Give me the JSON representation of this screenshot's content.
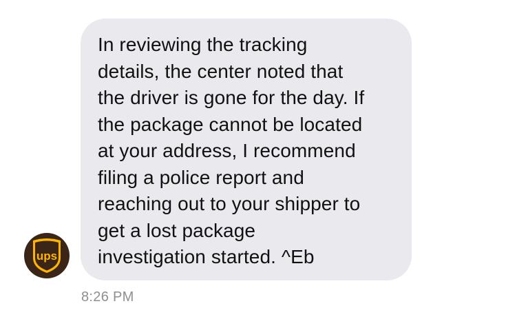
{
  "sender": {
    "avatar_icon": "ups-shield-logo-icon",
    "logo_text": "ups",
    "avatar_bg": "#3a2517",
    "shield_color": "#ffb500"
  },
  "message": {
    "lines": [
      "In reviewing the tracking",
      "details, the center noted that",
      "the driver is gone for the day. If",
      "the package cannot be located",
      "at your address, I recommend",
      "filing a police report and",
      "reaching out to your shipper to",
      "get a lost package",
      "investigation started. ^Eb"
    ],
    "bubble_color": "#e9e9ee",
    "text_color": "#111111"
  },
  "timestamp": "8:26 PM"
}
